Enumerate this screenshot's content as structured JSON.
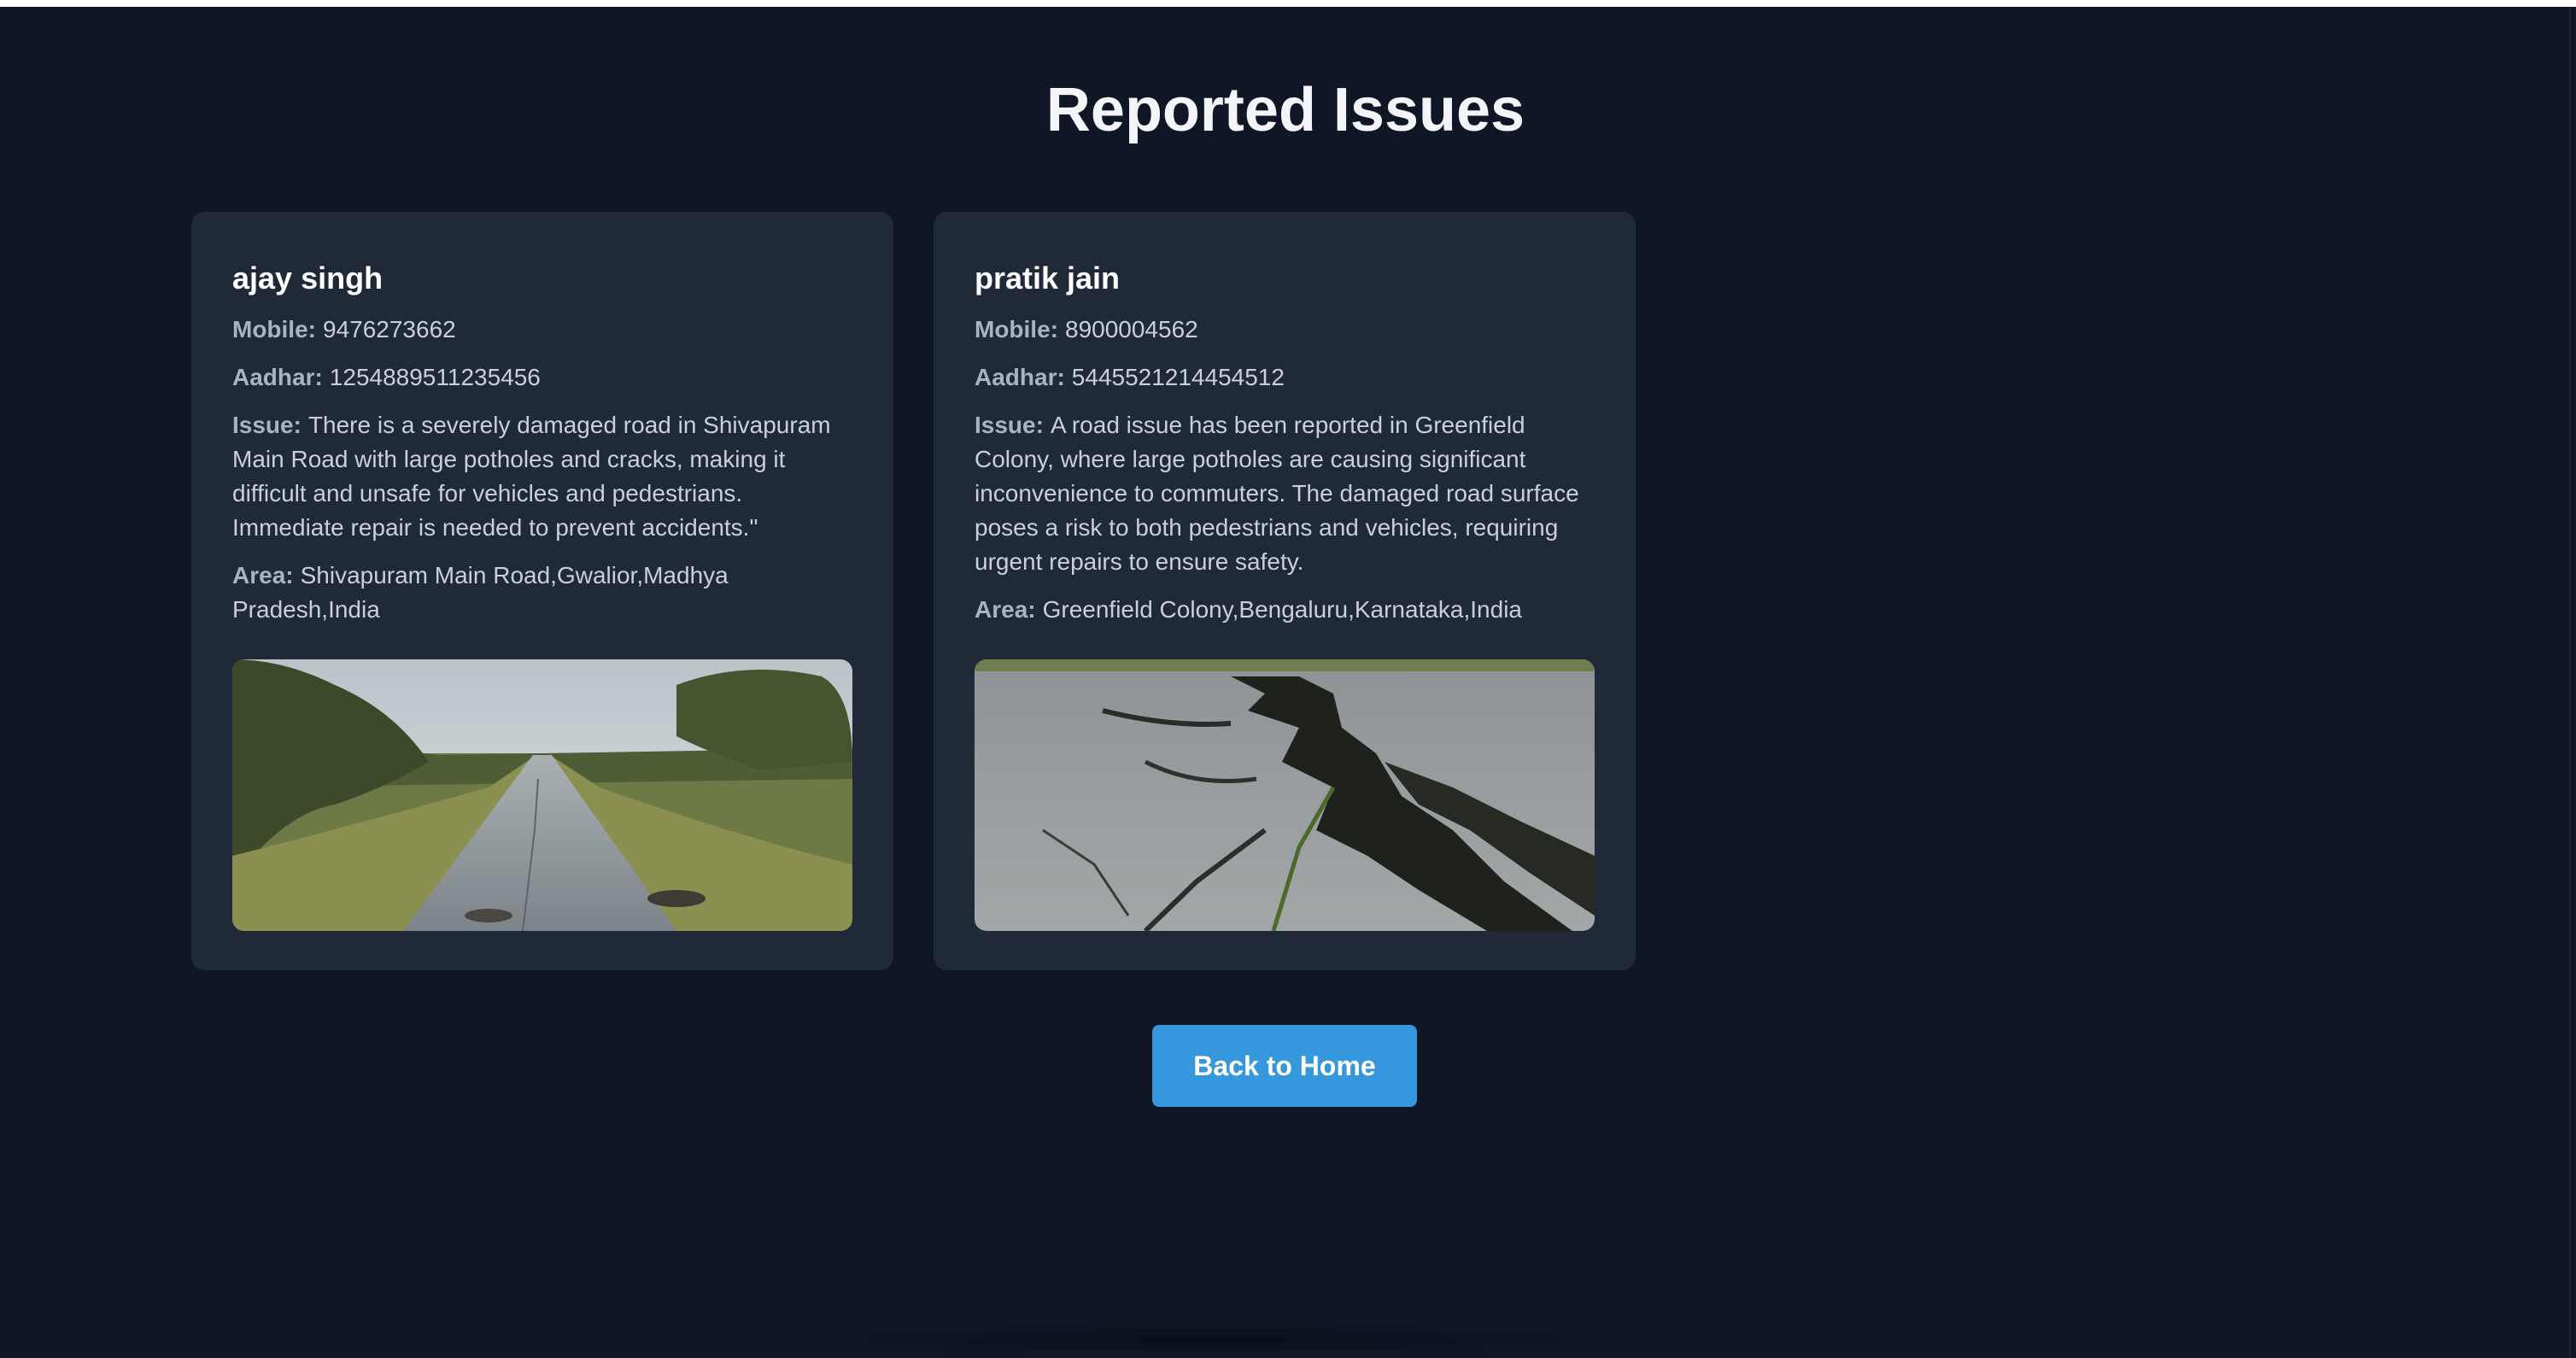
{
  "page": {
    "title": "Reported Issues"
  },
  "labels": {
    "mobile": "Mobile:",
    "aadhar": "Aadhar:",
    "issue": "Issue:",
    "area": "Area:"
  },
  "issues": [
    {
      "name": "ajay singh",
      "mobile": "9476273662",
      "aadhar": "1254889511235456",
      "issue": "There is a severely damaged road in Shivapuram Main Road with large potholes and cracks, making it difficult and unsafe for vehicles and pedestrians. Immediate repair is needed to prevent accidents.\"",
      "area": "Shivapuram Main Road,Gwalior,Madhya Pradesh,India",
      "image": "road-with-potholes-photo"
    },
    {
      "name": "pratik jain",
      "mobile": "8900004562",
      "aadhar": "5445521214454512",
      "issue": "A road issue has been reported in Greenfield Colony, where large potholes are causing significant inconvenience to commuters. The damaged road surface poses a risk to both pedestrians and vehicles, requiring urgent repairs to ensure safety.",
      "area": "Greenfield Colony,Bengaluru,Karnataka,India",
      "image": "cracked-asphalt-photo"
    }
  ],
  "actions": {
    "back_label": "Back to Home"
  },
  "colors": {
    "background": "#0f1727",
    "card": "#1f2938",
    "accent": "#3598dc",
    "text": "#c9d0da"
  }
}
